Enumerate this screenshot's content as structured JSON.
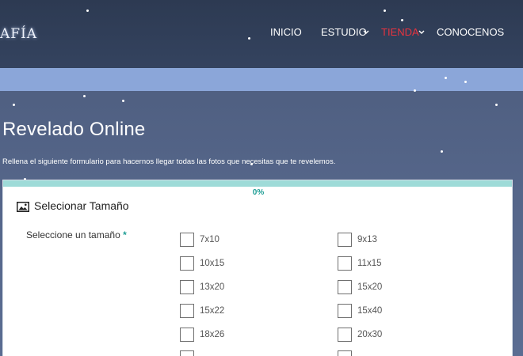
{
  "header": {
    "logo_text": "AFÍA",
    "nav": [
      {
        "label": "INICIO",
        "has_dropdown": false,
        "active": false
      },
      {
        "label": "ESTUDIO",
        "has_dropdown": true,
        "active": false
      },
      {
        "label": "TIENDA",
        "has_dropdown": true,
        "active": true
      },
      {
        "label": "CONOCENOS",
        "has_dropdown": false,
        "active": false
      }
    ],
    "active_color": "#e8333f"
  },
  "page": {
    "title": "Revelado Online",
    "intro": "Rellena el siguiente formulario para hacernos llegar todas las fotos que necesitas que te revelemos."
  },
  "form": {
    "progress_percent": 0,
    "progress_text": "0%",
    "section_icon": "image-icon",
    "section_title": "Selecionar Tamaño",
    "field_label": "Seleccione un tamaño",
    "required_mark": "*",
    "options_left": [
      "7x10",
      "10x15",
      "13x20",
      "15x22",
      "18x26"
    ],
    "options_right": [
      "9x13",
      "11x15",
      "15x20",
      "15x40",
      "20x30"
    ],
    "accent": "#1f9e95",
    "progress_track": "#9edbd8"
  },
  "colors": {
    "header_bg": "#2d3a52",
    "band": "#8ba6d9",
    "page_bg": "#55668a"
  }
}
